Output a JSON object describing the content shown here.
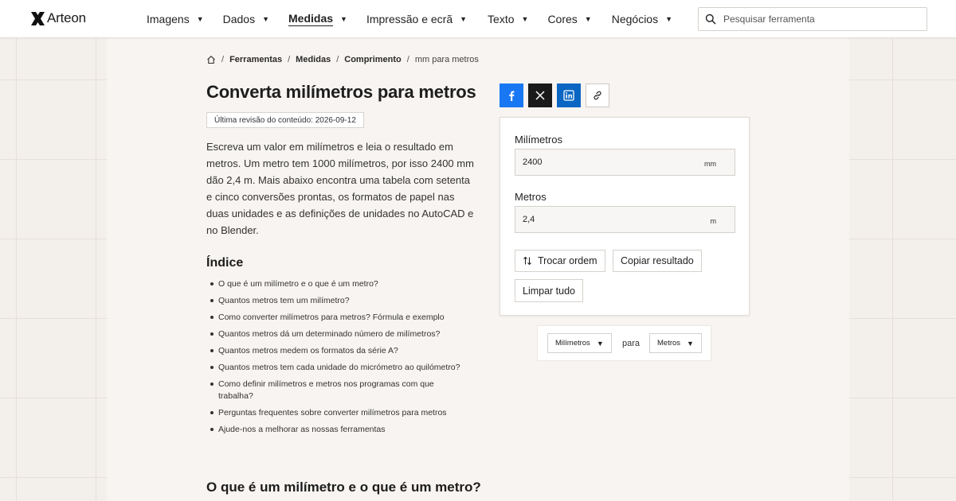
{
  "brand": {
    "name": "Arteon"
  },
  "nav": {
    "items": [
      {
        "label": "Imagens",
        "active": false
      },
      {
        "label": "Dados",
        "active": false
      },
      {
        "label": "Medidas",
        "active": true
      },
      {
        "label": "Impressão e ecrã",
        "active": false
      },
      {
        "label": "Texto",
        "active": false
      },
      {
        "label": "Cores",
        "active": false
      },
      {
        "label": "Negócios",
        "active": false
      }
    ]
  },
  "search": {
    "placeholder": "Pesquisar ferramenta"
  },
  "breadcrumb": {
    "items": [
      "Ferramentas",
      "Medidas",
      "Comprimento"
    ],
    "current": "mm para metros"
  },
  "page": {
    "title": "Converta milímetros para metros",
    "revision": "Última revisão do conteúdo: 2026-09-12",
    "intro": "Escreva um valor em milímetros e leia o resultado em metros. Um metro tem 1000 milímetros, por isso 2400 mm dão 2,4 m. Mais abaixo encontra uma tabela com setenta e cinco conversões prontas, os formatos de papel nas duas unidades e as definições de unidades no AutoCAD e no Blender."
  },
  "toc": {
    "title": "Índice",
    "items": [
      "O que é um milímetro e o que é um metro?",
      "Quantos metros tem um milímetro?",
      "Como converter milímetros para metros? Fórmula e exemplo",
      "Quantos metros dá um determinado número de milímetros?",
      "Quantos metros medem os formatos da série A?",
      "Quantos metros tem cada unidade do micrómetro ao quilómetro?",
      "Como definir milímetros e metros nos programas com que trabalha?",
      "Perguntas frequentes sobre converter milímetros para metros",
      "Ajude-nos a melhorar as nossas ferramentas"
    ]
  },
  "section": {
    "first_heading": "O que é um milímetro e o que é um metro?"
  },
  "share": {
    "icons": [
      "facebook-icon",
      "x-icon",
      "linkedin-icon",
      "link-icon"
    ]
  },
  "converter": {
    "from_label": "Milímetros",
    "from_value": "2400",
    "from_unit": "mm",
    "to_label": "Metros",
    "to_value": "2,4",
    "to_unit": "m",
    "swap_label": "Trocar ordem",
    "copy_label": "Copiar resultado",
    "clear_label": "Limpar tudo"
  },
  "selectors": {
    "from": "Milímetros",
    "joiner": "para",
    "to": "Metros"
  },
  "colors": {
    "facebook": "#1877f2",
    "x": "#1a1a1a",
    "linkedin": "#0a66c2",
    "page_bg": "#f3efeb"
  }
}
